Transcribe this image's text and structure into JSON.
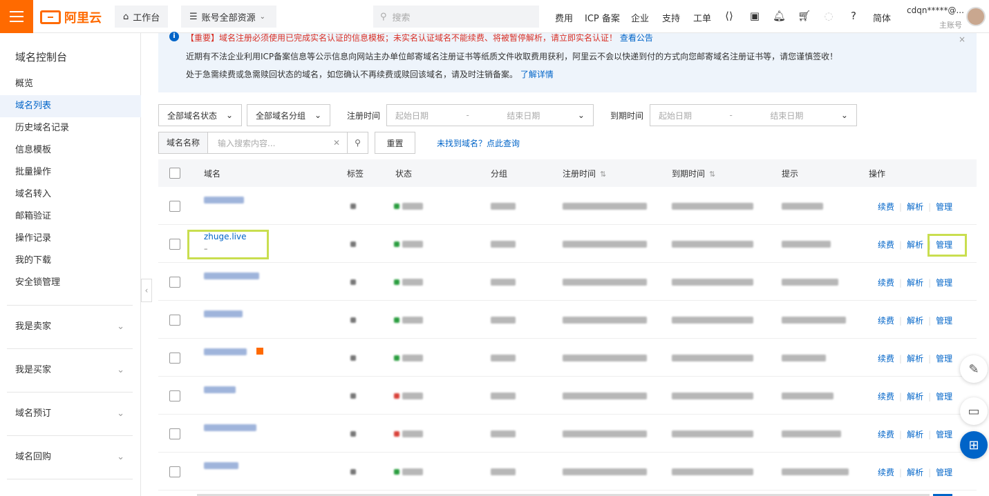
{
  "topbar": {
    "logo_text": "阿里云",
    "workbench": "工作台",
    "resources": "账号全部资源",
    "search_placeholder": "搜索",
    "nav": [
      "费用",
      "ICP 备案",
      "企业",
      "支持",
      "工单"
    ],
    "lang": "简体",
    "account_name": "cdqn*****@...",
    "account_role": "主账号"
  },
  "sidebar": {
    "title": "域名控制台",
    "items": [
      "概览",
      "域名列表",
      "历史域名记录",
      "信息模板",
      "批量操作",
      "域名转入",
      "邮箱验证",
      "操作记录",
      "我的下载",
      "安全锁管理"
    ],
    "active_index": 1,
    "groups": [
      "我是卖家",
      "我是买家",
      "域名预订",
      "域名回购"
    ]
  },
  "notice": {
    "line1": "【重要】域名注册必须使用已完成实名认证的信息模板；未实名认证域名不能续费、将被暂停解析，请立即实名认证！",
    "line1_link": "查看公告",
    "line2": "近期有不法企业利用ICP备案信息等公示信息向网站主办单位邮寄域名注册证书等纸质文件收取费用获利，阿里云不会以快递到付的方式向您邮寄域名注册证书等，请您谨慎签收！",
    "line3": "处于急需续费或急需赎回状态的域名，如您确认不再续费或赎回该域名，请及时注销备案。",
    "line3_link": "了解详情",
    "close": "×"
  },
  "filters": {
    "status_select": "全部域名状态",
    "group_select": "全部域名分组",
    "reg_time_label": "注册时间",
    "exp_time_label": "到期时间",
    "start_date": "起始日期",
    "end_date": "结束日期",
    "range_sep": "-",
    "name_field_label": "域名名称",
    "search_placeholder": "输入搜索内容...",
    "reset_button": "重置",
    "not_found_link": "未找到域名？点此查询"
  },
  "table": {
    "headers": [
      "域名",
      "标签",
      "状态",
      "分组",
      "注册时间",
      "到期时间",
      "提示",
      "操作"
    ],
    "sort_glyph": "⇅",
    "visible_domain": "zhuge.live",
    "visible_domain_sub": "–",
    "ops": [
      "续费",
      "解析",
      "管理"
    ],
    "op_sep": "|"
  }
}
